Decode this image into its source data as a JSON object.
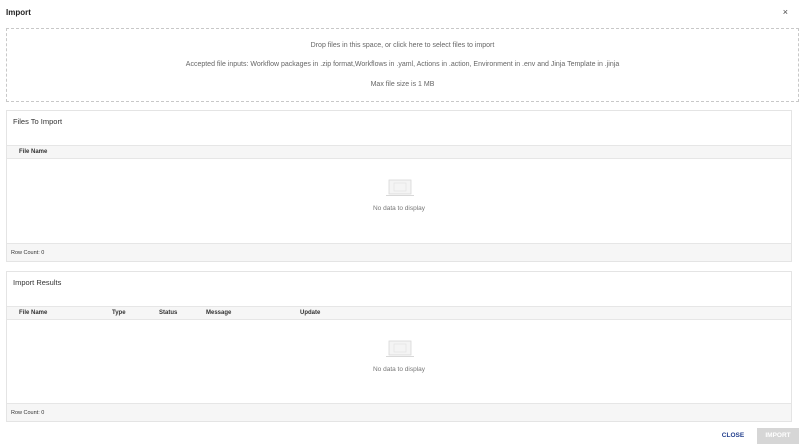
{
  "dialog": {
    "title": "Import",
    "close_icon": "close-icon",
    "close_glyph": "×"
  },
  "dropzone": {
    "line1": "Drop files in this space, or click here to select files to import",
    "line2": "Accepted file inputs: Workflow packages in .zip format,Workflows in .yaml, Actions in .action, Environment in .env and Jinja Template in .jinja",
    "line3": "Max file size is 1 MB"
  },
  "files_panel": {
    "title": "Files To Import",
    "columns": [
      "File Name"
    ],
    "empty_icon": "empty-box-icon",
    "empty_text": "No data to display",
    "row_count": "Row Count: 0"
  },
  "results_panel": {
    "title": "Import Results",
    "columns": [
      "File Name",
      "Type",
      "Status",
      "Message",
      "Update"
    ],
    "empty_icon": "empty-box-icon",
    "empty_text": "No data to display",
    "row_count": "Row Count: 0"
  },
  "footer": {
    "close_label": "CLOSE",
    "import_label": "IMPORT",
    "close_color": "#24408e",
    "import_disabled_color": "#d6d6d6"
  }
}
